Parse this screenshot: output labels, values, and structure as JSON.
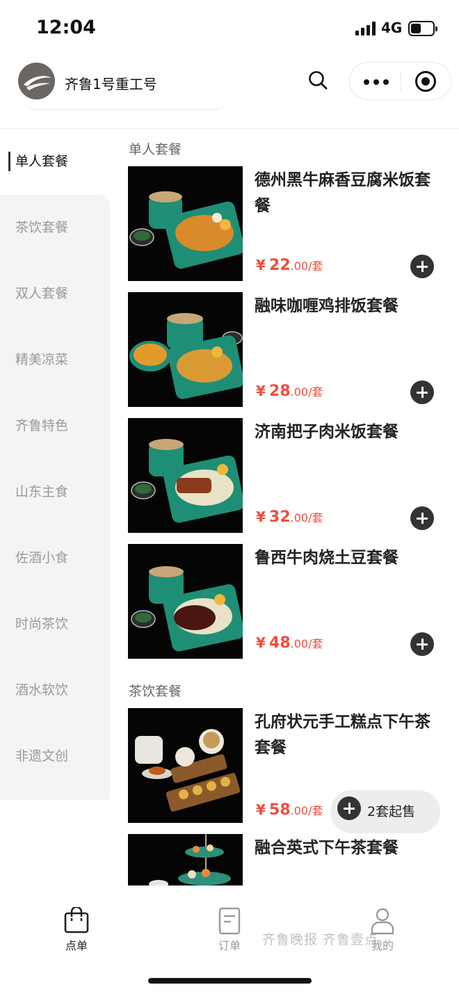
{
  "status_bar": {
    "time": "12:04",
    "network": "4G",
    "battery_level": 0.45
  },
  "header": {
    "app_name": "齐鲁1号重工号"
  },
  "sidebar": {
    "categories": [
      {
        "label": "单人套餐",
        "active": true
      },
      {
        "label": "茶饮套餐"
      },
      {
        "label": "双人套餐"
      },
      {
        "label": "精美凉菜"
      },
      {
        "label": "齐鲁特色"
      },
      {
        "label": "山东主食"
      },
      {
        "label": "佐酒小食"
      },
      {
        "label": "时尚茶饮"
      },
      {
        "label": "酒水软饮"
      },
      {
        "label": "非遗文创"
      }
    ]
  },
  "sections": [
    {
      "title": "单人套餐",
      "items": [
        {
          "name": "德州黑牛麻香豆腐米饭套餐",
          "currency": "¥",
          "price_int": "22",
          "price_dec": ".00",
          "unit": "/套"
        },
        {
          "name": "融味咖喱鸡排饭套餐",
          "currency": "¥",
          "price_int": "28",
          "price_dec": ".00",
          "unit": "/套"
        },
        {
          "name": "济南把子肉米饭套餐",
          "currency": "¥",
          "price_int": "32",
          "price_dec": ".00",
          "unit": "/套"
        },
        {
          "name": "鲁西牛肉烧土豆套餐",
          "currency": "¥",
          "price_int": "48",
          "price_dec": ".00",
          "unit": "/套"
        }
      ]
    },
    {
      "title": "茶饮套餐",
      "items": [
        {
          "name": "孔府状元手工糕点下午茶套餐",
          "currency": "¥",
          "price_int": "58",
          "price_dec": ".00",
          "unit": "/套",
          "min_order": "2套起售"
        },
        {
          "name": "融合英式下午茶套餐"
        }
      ]
    }
  ],
  "tabbar": {
    "tabs": [
      {
        "label": "点单",
        "active": true
      },
      {
        "label": "订单"
      },
      {
        "label": "我的"
      }
    ]
  },
  "watermark": "齐鲁晚报 齐鲁壹点",
  "colors": {
    "price": "#ef4e3d",
    "active_text": "#111111",
    "inactive_text": "#9a9a9a",
    "sidebar_bg": "#f4f4f4"
  }
}
